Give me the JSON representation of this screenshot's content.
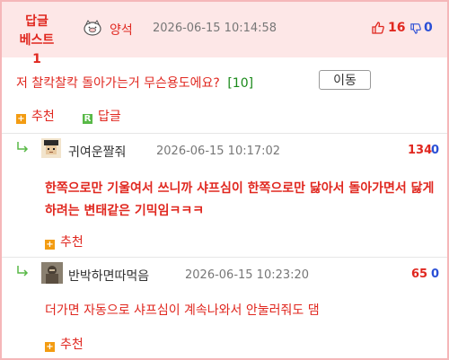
{
  "header": {
    "badge_line1": "답글",
    "badge_line2": "베스트1",
    "author": "양석",
    "date": "2026-06-15 10:14:58",
    "up_count": "16",
    "down_count": "0"
  },
  "post": {
    "title": "저 찰칵찰칵 돌아가는거 무슨용도에요?",
    "comment_count": "[10]",
    "move_button": "이동"
  },
  "actions": {
    "recommend": "추천",
    "reply": "답글"
  },
  "replies": [
    {
      "nickname": "귀여운짤줘",
      "date": "2026-06-15 10:17:02",
      "up": "134",
      "down": "0",
      "text": "한쪽으로만 기울여서 쓰니까 샤프심이 한쪽으로만 닳아서 돌아가면서 닳게하려는 변태같은 기믹임ㅋㅋㅋ",
      "recommend": "추천"
    },
    {
      "nickname": "반박하면따먹음",
      "date": "2026-06-15 10:23:20",
      "up": "65",
      "down": "0",
      "text": "더가면 자동으로 샤프심이 계속나와서 안눌러줘도 댐",
      "recommend": "추천"
    }
  ],
  "colors": {
    "accent_red": "#e0271f",
    "header_bg": "#fde7e7",
    "border_pink": "#f5b7b9",
    "down_blue": "#2a4fd6"
  }
}
